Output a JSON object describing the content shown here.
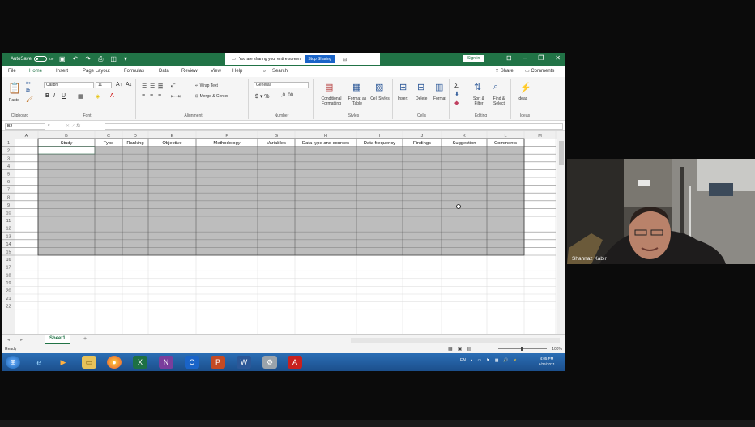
{
  "titlebar": {
    "autosave_label": "AutoSave",
    "autosave_state": "Off",
    "share_message": "You are sharing your entire screen.",
    "stop_sharing_label": "Stop Sharing",
    "signin_label": "Sign in"
  },
  "menu": {
    "items": [
      "File",
      "Home",
      "Insert",
      "Page Layout",
      "Formulas",
      "Data",
      "Review",
      "View",
      "Help"
    ],
    "active": "Home",
    "search_label": "Search",
    "share_label": "Share",
    "comments_label": "Comments"
  },
  "ribbon": {
    "paste_label": "Paste",
    "clipboard_label": "Clipboard",
    "font_name": "Calibri",
    "font_size": "11",
    "font_label": "Font",
    "wrap_text_label": "Wrap Text",
    "merge_center_label": "Merge & Center",
    "alignment_label": "Alignment",
    "number_format": "General",
    "number_label": "Number",
    "conditional_formatting_label": "Conditional Formatting",
    "format_as_table_label": "Format as Table",
    "cell_styles_label": "Cell Styles",
    "styles_label": "Styles",
    "insert_label": "Insert",
    "delete_label": "Delete",
    "format_label": "Format",
    "cells_label": "Cells",
    "sort_filter_label": "Sort & Filter",
    "find_select_label": "Find & Select",
    "editing_label": "Editing",
    "ideas_label": "Ideas",
    "ideas_group_label": "Ideas"
  },
  "formula_bar": {
    "name_box": "B2",
    "fx": "fx"
  },
  "grid": {
    "columns": [
      "A",
      "B",
      "C",
      "D",
      "E",
      "F",
      "G",
      "H",
      "I",
      "J",
      "K",
      "L",
      "M"
    ],
    "headers": [
      "Study",
      "Type",
      "Ranking",
      "Objective",
      "Methodology",
      "Variables",
      "Data type and sources",
      "Data frequency",
      "Findings",
      "Suggestion",
      "Comments"
    ],
    "row_numbers": [
      "1",
      "2",
      "3",
      "4",
      "5",
      "6",
      "7",
      "8",
      "9",
      "10",
      "11",
      "12",
      "13",
      "14",
      "15",
      "16",
      "17",
      "18",
      "19",
      "20",
      "21",
      "22"
    ]
  },
  "sheet": {
    "tab_label": "Sheet1",
    "add_label": "+"
  },
  "status": {
    "ready_label": "Ready",
    "zoom_label": "100%"
  },
  "taskbar": {
    "tray_lang": "EN",
    "time": "4:05 PM",
    "date": "6/26/2021"
  },
  "webcam": {
    "participant_name": "Shahnaz Kabir"
  }
}
